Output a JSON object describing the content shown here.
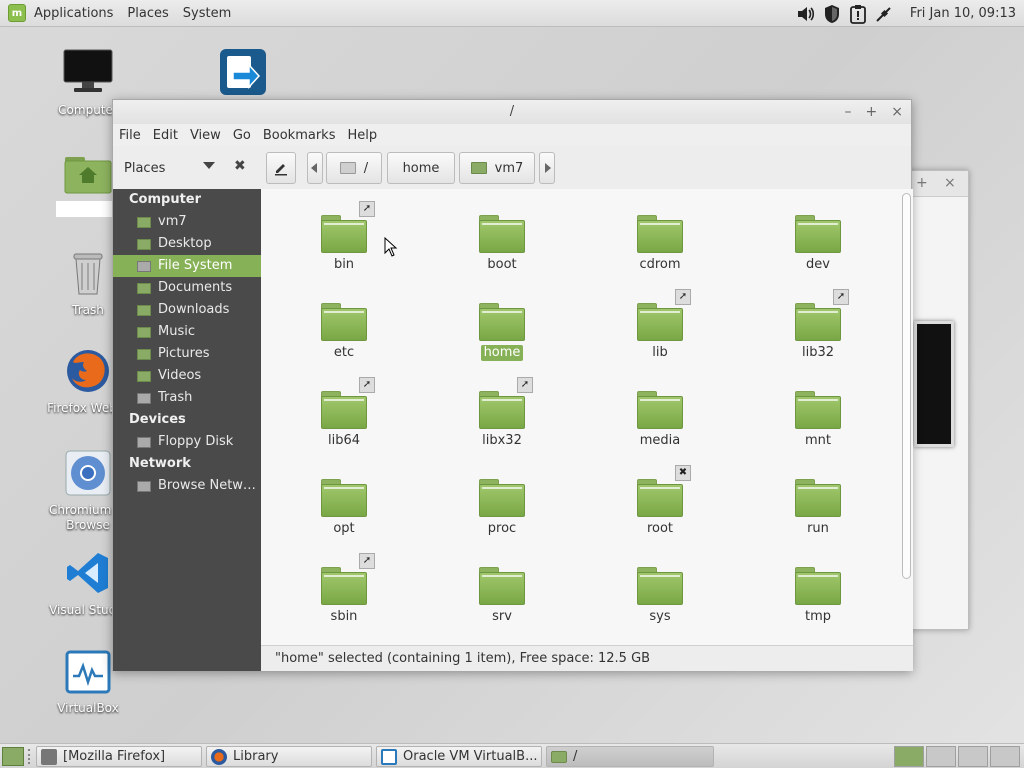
{
  "top_panel": {
    "menu": [
      "Applications",
      "Places",
      "System"
    ],
    "clock": "Fri Jan 10, 09:13",
    "tray_icons": [
      "volume-icon",
      "shield-icon",
      "update-icon",
      "network-icon"
    ]
  },
  "desktop": {
    "icons": [
      {
        "name": "computer",
        "label": "Computer",
        "icon": "monitor-icon"
      },
      {
        "name": "home",
        "label": "",
        "icon": "home-folder-icon"
      },
      {
        "name": "trash",
        "label": "Trash",
        "icon": "trash-icon"
      },
      {
        "name": "firefox",
        "label": "Firefox Web B",
        "icon": "firefox-icon"
      },
      {
        "name": "chromium",
        "label": "Chromium W",
        "label2": "Browse",
        "icon": "chromium-icon"
      },
      {
        "name": "vscode",
        "label": "Visual Studio",
        "icon": "vscode-icon"
      },
      {
        "name": "virtualbox",
        "label": "VirtualBox",
        "icon": "virtualbox-icon"
      },
      {
        "name": "freefilesync",
        "label": "",
        "icon": "freefilesync-icon"
      }
    ]
  },
  "window": {
    "title": "/",
    "controls": [
      "–",
      "+",
      "×"
    ],
    "menu": [
      "File",
      "Edit",
      "View",
      "Go",
      "Bookmarks",
      "Help"
    ],
    "places_selector": "Places",
    "breadcrumbs": [
      "/",
      "home",
      "vm7"
    ],
    "sidebar": {
      "sections": [
        {
          "header": "Computer",
          "items": [
            {
              "label": "vm7",
              "active": false
            },
            {
              "label": "Desktop",
              "active": false
            },
            {
              "label": "File System",
              "active": true
            },
            {
              "label": "Documents",
              "active": false
            },
            {
              "label": "Downloads",
              "active": false
            },
            {
              "label": "Music",
              "active": false
            },
            {
              "label": "Pictures",
              "active": false
            },
            {
              "label": "Videos",
              "active": false
            },
            {
              "label": "Trash",
              "active": false
            }
          ]
        },
        {
          "header": "Devices",
          "items": [
            {
              "label": "Floppy Disk",
              "active": false
            }
          ]
        },
        {
          "header": "Network",
          "items": [
            {
              "label": "Browse Netw…",
              "active": false
            }
          ]
        }
      ]
    },
    "files": [
      {
        "name": "bin",
        "badge": "link"
      },
      {
        "name": "boot",
        "badge": ""
      },
      {
        "name": "cdrom",
        "badge": ""
      },
      {
        "name": "dev",
        "badge": ""
      },
      {
        "name": "etc",
        "badge": ""
      },
      {
        "name": "home",
        "badge": "",
        "selected": true
      },
      {
        "name": "lib",
        "badge": "link"
      },
      {
        "name": "lib32",
        "badge": "link"
      },
      {
        "name": "lib64",
        "badge": "link"
      },
      {
        "name": "libx32",
        "badge": "link"
      },
      {
        "name": "media",
        "badge": ""
      },
      {
        "name": "mnt",
        "badge": ""
      },
      {
        "name": "opt",
        "badge": ""
      },
      {
        "name": "proc",
        "badge": ""
      },
      {
        "name": "root",
        "badge": "locked"
      },
      {
        "name": "run",
        "badge": ""
      },
      {
        "name": "sbin",
        "badge": "link"
      },
      {
        "name": "srv",
        "badge": ""
      },
      {
        "name": "sys",
        "badge": ""
      },
      {
        "name": "tmp",
        "badge": ""
      }
    ],
    "status": "\"home\" selected (containing 1 item), Free space: 12.5 GB"
  },
  "taskbar": {
    "tasks": [
      {
        "label": "[Mozilla Firefox]",
        "icon": "firefox-icon",
        "active": false
      },
      {
        "label": "Library",
        "icon": "firefox-icon",
        "active": false
      },
      {
        "label": "Oracle VM VirtualB...",
        "icon": "virtualbox-icon",
        "active": false
      },
      {
        "label": "/",
        "icon": "folder-icon",
        "active": true
      }
    ],
    "workspaces": 4
  },
  "colors": {
    "accent": "#87b157",
    "sidebar_bg": "#4a4a4a",
    "folder": "#8aab66"
  }
}
